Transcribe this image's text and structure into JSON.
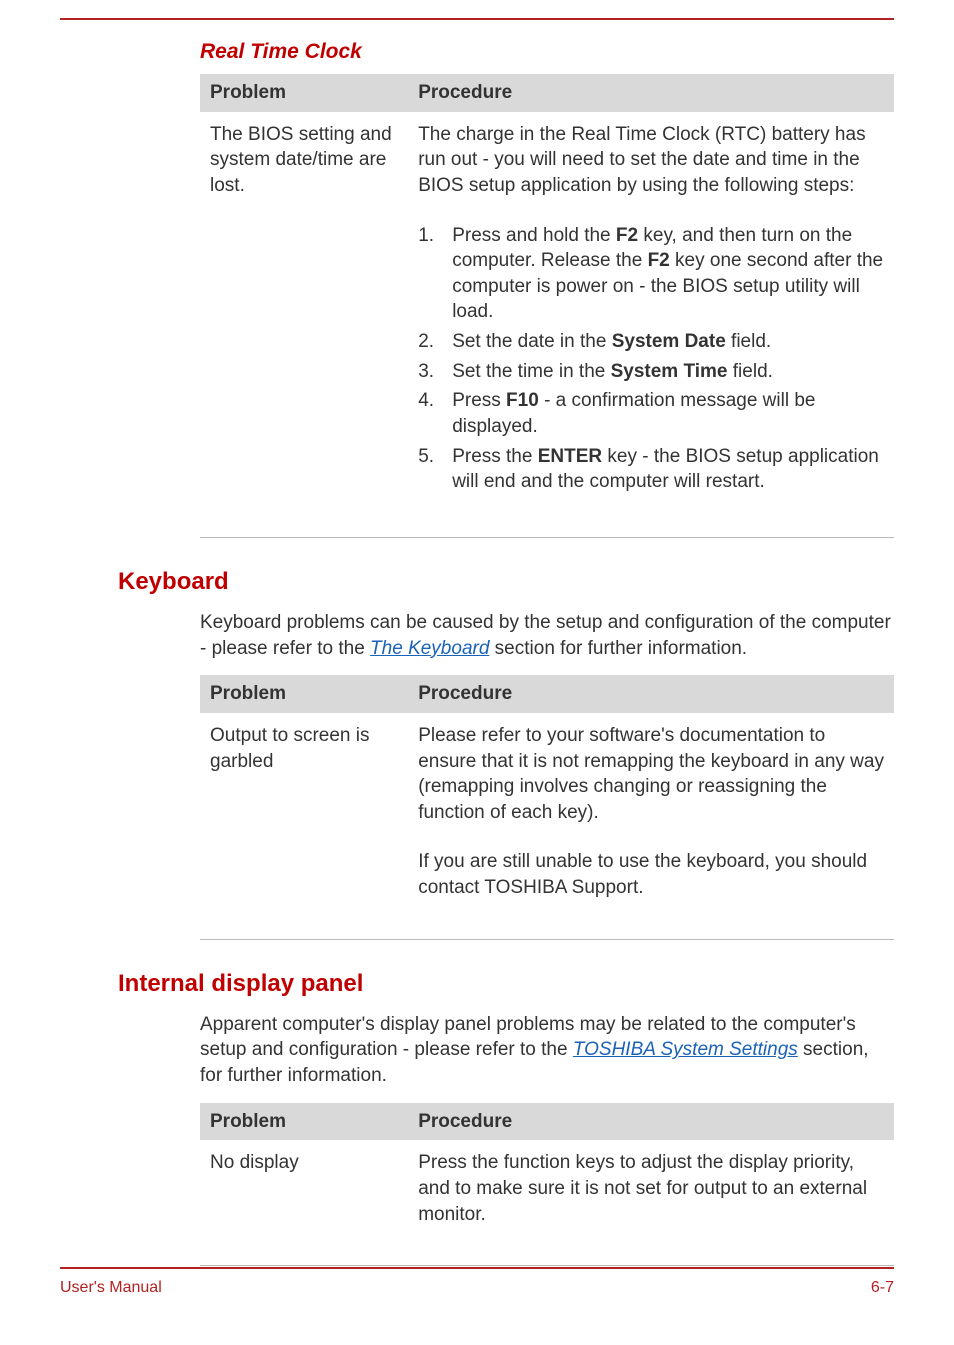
{
  "sections": {
    "rtc": {
      "title": "Real Time Clock",
      "table": {
        "headers": {
          "problem": "Problem",
          "procedure": "Procedure"
        },
        "problem": "The BIOS setting and system date/time are lost.",
        "intro": "The charge in the Real Time Clock (RTC) battery has run out - you will need to set the date and time in the BIOS setup application by using the following steps:",
        "steps": {
          "s1a": "Press and hold the ",
          "s1b": "F2",
          "s1c": " key, and then turn on the computer. Release the ",
          "s1d": "F2",
          "s1e": " key one second after the computer is power on - the BIOS setup utility will load.",
          "s2a": "Set the date in the ",
          "s2b": "System Date",
          "s2c": " field.",
          "s3a": "Set the time in the ",
          "s3b": "System Time",
          "s3c": " field.",
          "s4a": "Press ",
          "s4b": "F10",
          "s4c": " - a confirmation message will be displayed.",
          "s5a": "Press the ",
          "s5b": "ENTER",
          "s5c": " key - the BIOS setup application will end and the computer will restart."
        }
      }
    },
    "keyboard": {
      "title": "Keyboard",
      "intro_a": "Keyboard problems can be caused by the setup and configuration of the computer - please refer to the ",
      "intro_link": "The Keyboard",
      "intro_b": " section for further information.",
      "table": {
        "headers": {
          "problem": "Problem",
          "procedure": "Procedure"
        },
        "problem": "Output to screen is garbled",
        "proc1": "Please refer to your software's documentation to ensure that it is not remapping the keyboard in any way (remapping involves changing or reassigning the function of each key).",
        "proc2": "If you are still unable to use the keyboard, you should contact TOSHIBA Support."
      }
    },
    "display": {
      "title": "Internal display panel",
      "intro_a": "Apparent computer's display panel problems may be related to the computer's setup and configuration - please refer to the ",
      "intro_link": "TOSHIBA System Settings",
      "intro_b": " section, for further information.",
      "table": {
        "headers": {
          "problem": "Problem",
          "procedure": "Procedure"
        },
        "problem": "No display",
        "proc": "Press the function keys to adjust the display priority, and to make sure it is not set for output to an external monitor."
      }
    }
  },
  "footer": {
    "left": "User's Manual",
    "right": "6-7"
  }
}
